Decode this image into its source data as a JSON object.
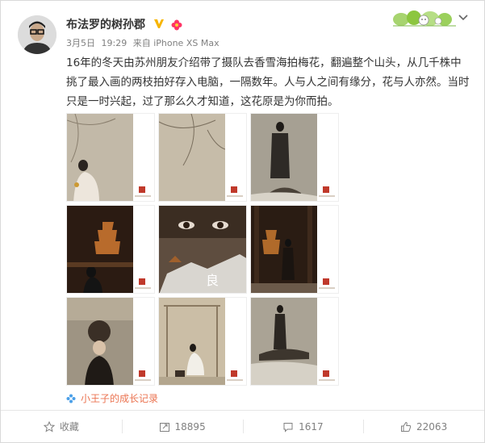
{
  "post": {
    "username": "布法罗的树孙郡",
    "date": "3月5日",
    "time": "19:29",
    "source": "来自 iPhone XS Max",
    "content": "16年的冬天由苏州朋友介绍带了摄队去香雪海拍梅花，翻遍整个山头，从几千株中挑了最入画的两枝拍好存入电脑，一隔数年。人与人之间有缘分，花与人亦然。当时只是一时兴起，过了那么久才知道，这花原是为你而拍。"
  },
  "images": [
    {
      "tone": "#bdb4a3"
    },
    {
      "tone": "#c4b9a6"
    },
    {
      "tone": "#a39d8f"
    },
    {
      "tone": "#2d1c12"
    },
    {
      "tone": "#5b4a3c"
    },
    {
      "tone": "#2b1d14"
    },
    {
      "tone": "#9c9282"
    },
    {
      "tone": "#c8bca6"
    },
    {
      "tone": "#a9a294"
    }
  ],
  "album": {
    "label": "小王子的成长记录"
  },
  "actions": {
    "favorite": "收藏",
    "reposts": "18895",
    "comments": "1617",
    "likes": "22063"
  },
  "colors": {
    "accent": "#eb7350",
    "text": "#333333",
    "meta": "#808080"
  }
}
